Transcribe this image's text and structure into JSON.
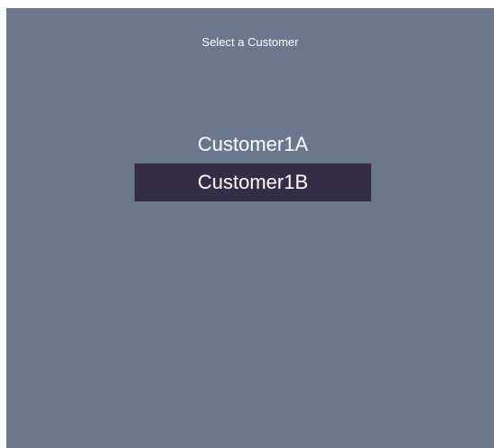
{
  "dialog": {
    "title": "Select a Customer"
  },
  "customers": {
    "items": [
      {
        "label": "Customer1A",
        "selected": false
      },
      {
        "label": "Customer1B",
        "selected": true
      }
    ]
  },
  "colors": {
    "panel_background": "#6b778c",
    "selected_background": "#352c45",
    "text": "#ffffff"
  }
}
